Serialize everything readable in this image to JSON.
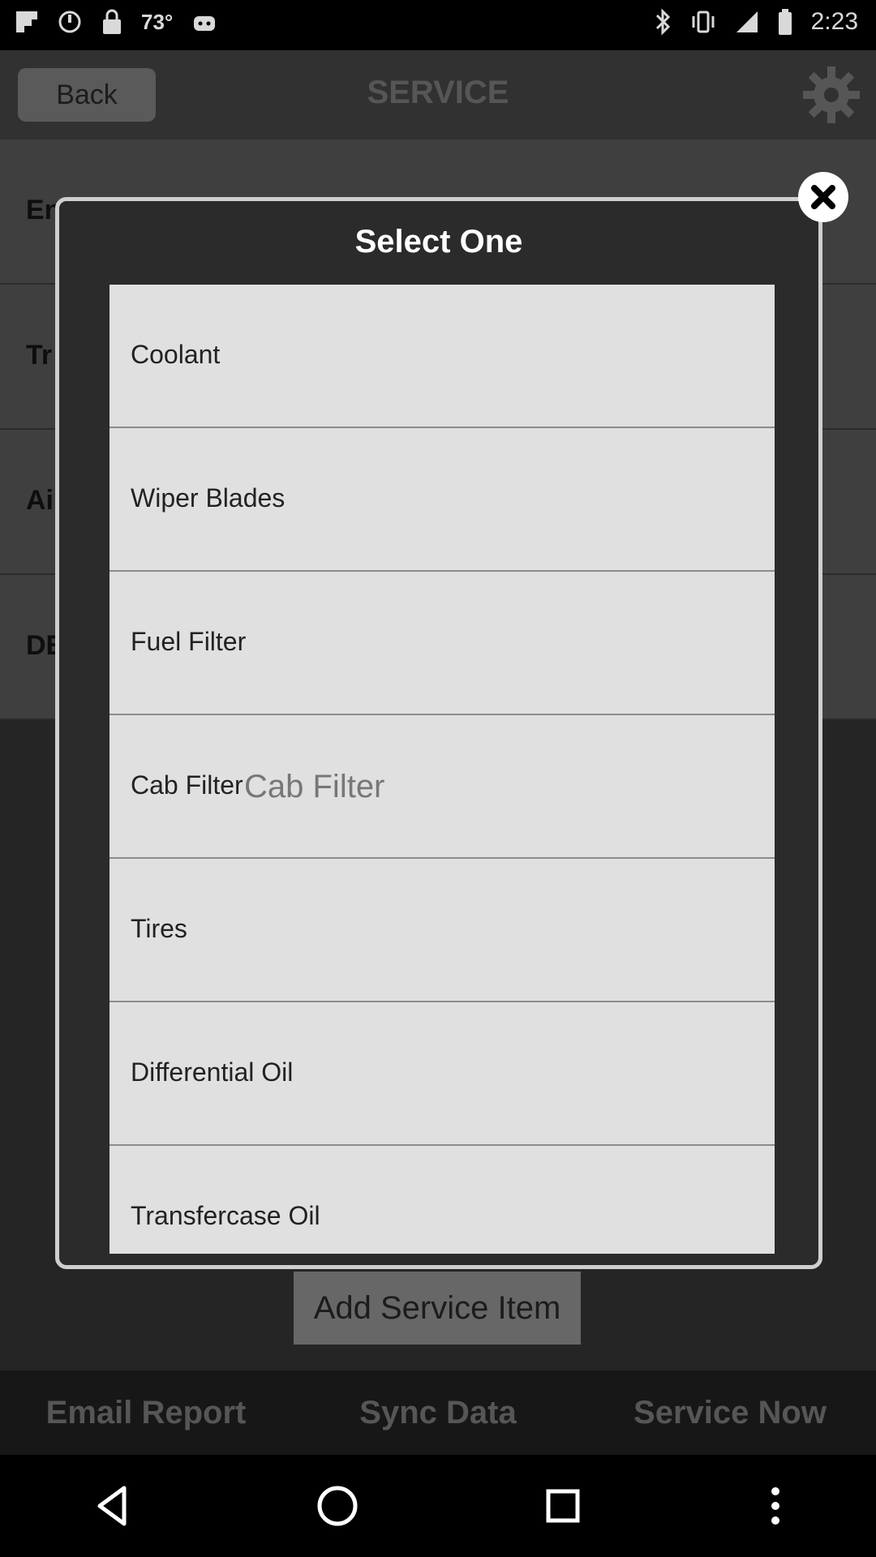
{
  "status_bar": {
    "temperature": "73°",
    "time": "2:23"
  },
  "app_header": {
    "back_label": "Back",
    "title": "SERVICE"
  },
  "background_rows": [
    "En",
    "Tr",
    "Ai",
    "DE"
  ],
  "dialog": {
    "title": "Select One",
    "items": [
      {
        "label": "Coolant",
        "hint": ""
      },
      {
        "label": "Wiper Blades",
        "hint": ""
      },
      {
        "label": "Fuel Filter",
        "hint": ""
      },
      {
        "label": "Cab Filter",
        "hint": "Cab Filter"
      },
      {
        "label": "Tires",
        "hint": ""
      },
      {
        "label": "Differential Oil",
        "hint": ""
      },
      {
        "label": "Transfercase Oil",
        "hint": ""
      }
    ]
  },
  "add_button_label": "Add Service Item",
  "bottom_bar": {
    "email_report": "Email Report",
    "sync_data": "Sync Data",
    "service_now": "Service Now"
  }
}
